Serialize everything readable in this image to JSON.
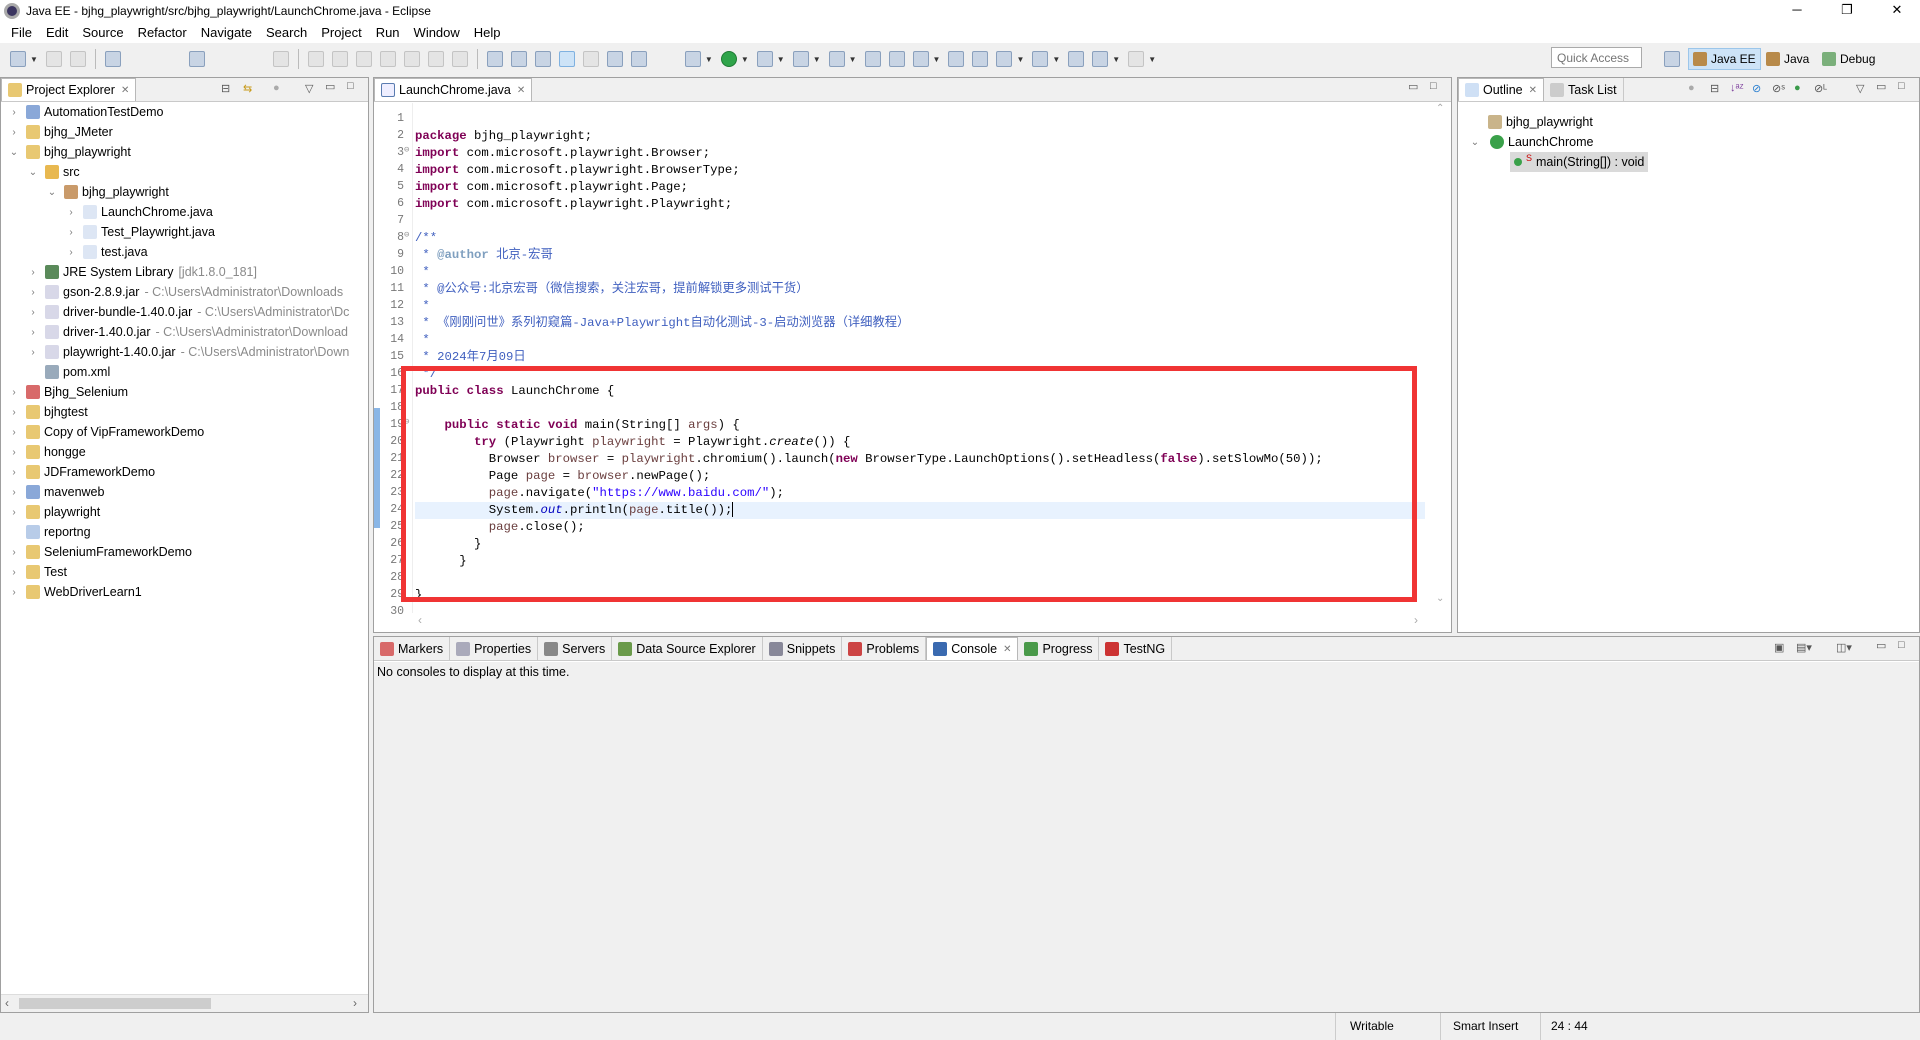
{
  "window": {
    "title": "Java EE - bjhg_playwright/src/bjhg_playwright/LaunchChrome.java - Eclipse",
    "minimize": "─",
    "maximize": "❐",
    "close": "✕"
  },
  "menu": [
    "File",
    "Edit",
    "Source",
    "Refactor",
    "Navigate",
    "Search",
    "Project",
    "Run",
    "Window",
    "Help"
  ],
  "toolbar": {
    "quick_access_placeholder": "Quick Access",
    "perspectives": [
      {
        "label": "Java EE",
        "active": true
      },
      {
        "label": "Java",
        "active": false
      },
      {
        "label": "Debug",
        "active": false
      }
    ]
  },
  "project_explorer": {
    "tab": "Project Explorer",
    "items": [
      {
        "label": "AutomationTestDemo",
        "depth": 0,
        "twisty": "closed",
        "icon": "maven-project-icon"
      },
      {
        "label": "bjhg_JMeter",
        "depth": 0,
        "twisty": "closed",
        "icon": "project-folder-icon"
      },
      {
        "label": "bjhg_playwright",
        "depth": 0,
        "twisty": "open",
        "icon": "project-folder-icon"
      },
      {
        "label": "src",
        "depth": 1,
        "twisty": "open",
        "icon": "source-folder-icon"
      },
      {
        "label": "bjhg_playwright",
        "depth": 2,
        "twisty": "open",
        "icon": "package-icon"
      },
      {
        "label": "LaunchChrome.java",
        "depth": 3,
        "twisty": "closed",
        "icon": "java-file-icon"
      },
      {
        "label": "Test_Playwright.java",
        "depth": 3,
        "twisty": "closed",
        "icon": "java-file-icon"
      },
      {
        "label": "test.java",
        "depth": 3,
        "twisty": "closed",
        "icon": "java-file-icon"
      },
      {
        "label": "JRE System Library",
        "suffix": "[jdk1.8.0_181]",
        "depth": 1,
        "twisty": "closed",
        "icon": "library-icon"
      },
      {
        "label": "gson-2.8.9.jar",
        "suffix": "- C:\\Users\\Administrator\\Downloads",
        "depth": 1,
        "twisty": "closed",
        "icon": "jar-icon"
      },
      {
        "label": "driver-bundle-1.40.0.jar",
        "suffix": "- C:\\Users\\Administrator\\Dc",
        "depth": 1,
        "twisty": "closed",
        "icon": "jar-icon"
      },
      {
        "label": "driver-1.40.0.jar",
        "suffix": "- C:\\Users\\Administrator\\Download",
        "depth": 1,
        "twisty": "closed",
        "icon": "jar-icon"
      },
      {
        "label": "playwright-1.40.0.jar",
        "suffix": "- C:\\Users\\Administrator\\Down",
        "depth": 1,
        "twisty": "closed",
        "icon": "jar-icon"
      },
      {
        "label": "pom.xml",
        "depth": 1,
        "twisty": "none",
        "icon": "maven-file-icon"
      },
      {
        "label": "Bjhg_Selenium",
        "depth": 0,
        "twisty": "closed",
        "icon": "project-error-icon"
      },
      {
        "label": "bjhgtest",
        "depth": 0,
        "twisty": "closed",
        "icon": "project-folder-icon"
      },
      {
        "label": "Copy of VipFrameworkDemo",
        "depth": 0,
        "twisty": "closed",
        "icon": "project-folder-icon"
      },
      {
        "label": "hongge",
        "depth": 0,
        "twisty": "closed",
        "icon": "project-folder-icon"
      },
      {
        "label": "JDFrameworkDemo",
        "depth": 0,
        "twisty": "closed",
        "icon": "project-folder-icon"
      },
      {
        "label": "mavenweb",
        "depth": 0,
        "twisty": "closed",
        "icon": "maven-project-icon"
      },
      {
        "label": "playwright",
        "depth": 0,
        "twisty": "closed",
        "icon": "project-folder-icon"
      },
      {
        "label": "reportng",
        "depth": 0,
        "twisty": "none",
        "icon": "folder-icon"
      },
      {
        "label": "SeleniumFrameworkDemo",
        "depth": 0,
        "twisty": "closed",
        "icon": "project-folder-icon"
      },
      {
        "label": "Test",
        "depth": 0,
        "twisty": "closed",
        "icon": "project-folder-icon"
      },
      {
        "label": "WebDriverLearn1",
        "depth": 0,
        "twisty": "closed",
        "icon": "project-folder-icon"
      }
    ]
  },
  "editor": {
    "tab": "LaunchChrome.java",
    "current_line": 24,
    "lines": [
      [],
      [
        [
          "package",
          "kw"
        ],
        [
          " bjhg_playwright;",
          ""
        ]
      ],
      [
        [
          "import",
          "kw"
        ],
        [
          " com.microsoft.playwright.Browser;",
          ""
        ]
      ],
      [
        [
          "import",
          "kw"
        ],
        [
          " com.microsoft.playwright.BrowserType;",
          ""
        ]
      ],
      [
        [
          "import",
          "kw"
        ],
        [
          " com.microsoft.playwright.Page;",
          ""
        ]
      ],
      [
        [
          "import",
          "kw"
        ],
        [
          " com.microsoft.playwright.Playwright;",
          ""
        ]
      ],
      [],
      [
        [
          "/**",
          "cm"
        ]
      ],
      [
        [
          " * ",
          "cm"
        ],
        [
          "@author",
          "cmtag"
        ],
        [
          " 北京-宏哥",
          "cm"
        ]
      ],
      [
        [
          " *",
          "cm"
        ]
      ],
      [
        [
          " * @公众号:北京宏哥（微信搜索，关注宏哥，提前解锁更多测试干货）",
          "cm"
        ]
      ],
      [
        [
          " *",
          "cm"
        ]
      ],
      [
        [
          " * 《刚刚问世》系列初窥篇-Java+Playwright自动化测试-3-启动浏览器（详细教程）",
          "cm"
        ]
      ],
      [
        [
          " *",
          "cm"
        ]
      ],
      [
        [
          " * 2024年7月09日",
          "cm"
        ]
      ],
      [
        [
          " */",
          "cm"
        ]
      ],
      [
        [
          "public",
          "kw"
        ],
        [
          " ",
          ""
        ],
        [
          "class",
          "kw"
        ],
        [
          " LaunchChrome {",
          ""
        ]
      ],
      [],
      [
        [
          "    ",
          ""
        ],
        [
          "public",
          "kw"
        ],
        [
          " ",
          ""
        ],
        [
          "static",
          "kw"
        ],
        [
          " ",
          ""
        ],
        [
          "void",
          "kw"
        ],
        [
          " main(String[] ",
          ""
        ],
        [
          "args",
          "var"
        ],
        [
          ") {",
          ""
        ]
      ],
      [
        [
          "        ",
          ""
        ],
        [
          "try",
          "kw"
        ],
        [
          " (Playwright ",
          ""
        ],
        [
          "playwright",
          "var"
        ],
        [
          " = Playwright.",
          ""
        ],
        [
          "create",
          "st"
        ],
        [
          "()) {",
          ""
        ]
      ],
      [
        [
          "          Browser ",
          ""
        ],
        [
          "browser",
          "var"
        ],
        [
          " = ",
          ""
        ],
        [
          "playwright",
          "var"
        ],
        [
          ".chromium().launch(",
          ""
        ],
        [
          "new",
          "kw"
        ],
        [
          " BrowserType.LaunchOptions().setHeadless(",
          ""
        ],
        [
          "false",
          "kw"
        ],
        [
          ").setSlowMo(50));",
          ""
        ]
      ],
      [
        [
          "          Page ",
          ""
        ],
        [
          "page",
          "var"
        ],
        [
          " = ",
          ""
        ],
        [
          "browser",
          "var"
        ],
        [
          ".newPage();",
          ""
        ]
      ],
      [
        [
          "          ",
          ""
        ],
        [
          "page",
          "var"
        ],
        [
          ".navigate(",
          ""
        ],
        [
          "\"https://www.baidu.com/\"",
          "str"
        ],
        [
          ");",
          ""
        ]
      ],
      [
        [
          "          System.",
          ""
        ],
        [
          "out",
          "fld"
        ],
        [
          ".println(",
          ""
        ],
        [
          "page",
          "var"
        ],
        [
          ".title());",
          ""
        ]
      ],
      [
        [
          "          ",
          ""
        ],
        [
          "page",
          "var"
        ],
        [
          ".close();",
          ""
        ]
      ],
      [
        [
          "        }",
          ""
        ]
      ],
      [
        [
          "      }",
          ""
        ]
      ],
      [],
      [
        [
          "}",
          ""
        ]
      ],
      []
    ]
  },
  "outline": {
    "tabs": [
      "Outline",
      "Task List"
    ],
    "items": [
      {
        "label": "bjhg_playwright",
        "icon": "package-icon"
      },
      {
        "label": "LaunchChrome",
        "icon": "class-icon"
      },
      {
        "label": "main(String[]) : void",
        "icon": "public-method-icon",
        "badge": "S"
      }
    ]
  },
  "bottom": {
    "tabs": [
      {
        "label": "Markers"
      },
      {
        "label": "Properties"
      },
      {
        "label": "Servers"
      },
      {
        "label": "Data Source Explorer"
      },
      {
        "label": "Snippets"
      },
      {
        "label": "Problems"
      },
      {
        "label": "Console",
        "active": true
      },
      {
        "label": "Progress"
      },
      {
        "label": "TestNG"
      }
    ],
    "message": "No consoles to display at this time."
  },
  "status": {
    "writable": "Writable",
    "insert_mode": "Smart Insert",
    "position": "24 : 44"
  },
  "colors": {
    "highlight_box": "#f03434",
    "current_line": "#e8f2fe"
  }
}
